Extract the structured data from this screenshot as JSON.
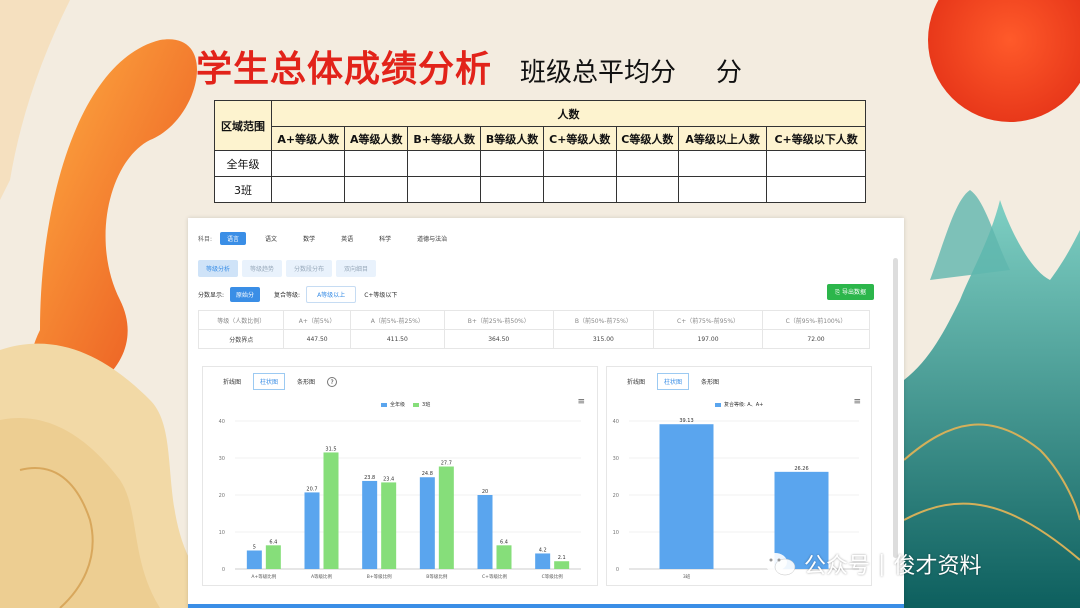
{
  "title": {
    "main": "学生总体成绩分析",
    "sub": "班级总平均分",
    "unit": "分"
  },
  "summary_table": {
    "corner": "区域范围",
    "group_header": "人数",
    "columns": [
      "A+等级人数",
      "A等级人数",
      "B+等级人数",
      "B等级人数",
      "C+等级人数",
      "C等级人数",
      "A等级以上人数",
      "C+等级以下人数"
    ],
    "rows": [
      "全年级",
      "3班"
    ]
  },
  "screen": {
    "subject_label": "科目:",
    "subjects": [
      "语言",
      "语文",
      "数学",
      "英语",
      "科学",
      "道德与法治"
    ],
    "tabs": [
      "等级分析",
      "等级趋势",
      "分数段分布",
      "双向细目"
    ],
    "controls": {
      "score_label": "分数显示:",
      "score_btn": "原始分",
      "mix_label": "复合等级:",
      "mix_value": "A等级以上",
      "mix_low": "C+等级以下",
      "export": "导出数据"
    },
    "grid": {
      "headers": [
        "等级（人数比例）",
        "A+（前5%）",
        "A（前5%-前25%）",
        "B+（前25%-前50%）",
        "B（前50%-前75%）",
        "C+（前75%-前95%）",
        "C（前95%-前100%）"
      ],
      "row_label": "分数界点",
      "values": [
        "447.50",
        "411.50",
        "364.50",
        "315.00",
        "197.00",
        "72.00"
      ]
    },
    "chart_tabs": [
      "折线图",
      "柱状图",
      "条形图"
    ],
    "help_icon": "?",
    "menu_icon": "≡"
  },
  "chart_data": [
    {
      "type": "bar",
      "categories": [
        "A+等级比例",
        "A等级比例",
        "B+等级比例",
        "B等级比例",
        "C+等级比例",
        "C等级比例"
      ],
      "series": [
        {
          "name": "全年级",
          "color": "#5aa5ee",
          "values": [
            5,
            20.7,
            23.8,
            24.8,
            20,
            4.2
          ]
        },
        {
          "name": "3班",
          "color": "#86de7a",
          "values": [
            6.4,
            31.5,
            23.4,
            27.7,
            6.4,
            2.1
          ]
        }
      ],
      "yticks": [
        0,
        10,
        20,
        30,
        40
      ],
      "ylim": [
        0,
        40
      ]
    },
    {
      "type": "bar",
      "categories": [
        "3班",
        ""
      ],
      "series": [
        {
          "name": "复合等级: A、A+",
          "color": "#5aa5ee",
          "values": [
            39.13,
            26.26
          ]
        }
      ],
      "yticks": [
        0,
        10,
        20,
        30,
        40
      ],
      "ylim": [
        0,
        40
      ]
    }
  ],
  "watermark": {
    "brand": "公众号",
    "name": "俊才资料"
  }
}
